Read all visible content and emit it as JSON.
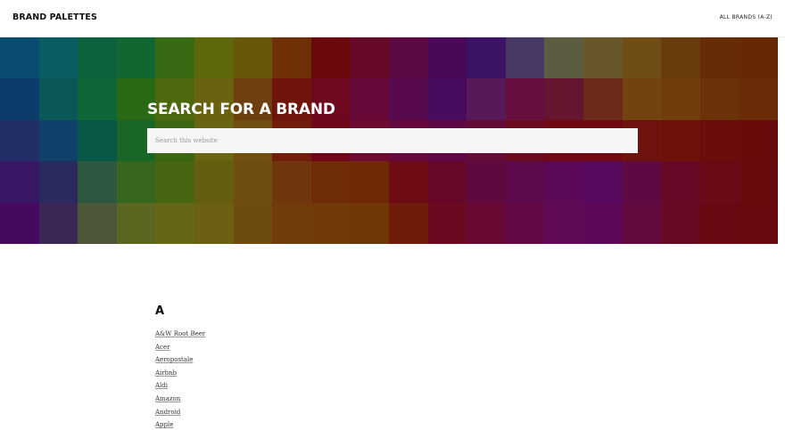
{
  "header": {
    "site_title": "BRAND PALETTES",
    "nav_link": "ALL BRANDS (A-Z)"
  },
  "hero": {
    "title": "SEARCH FOR A BRAND",
    "search_placeholder": "Search this website",
    "mosaic_colors": [
      "#0b4f73",
      "#0a5f66",
      "#0e6640",
      "#136a33",
      "#3a6d14",
      "#626c0c",
      "#6d5a0a",
      "#733208",
      "#6e0a0c",
      "#6a0a2a",
      "#5d0a45",
      "#4d0a5a",
      "#3d1468",
      "#4a3a6a",
      "#5f5f46",
      "#6c5a2a",
      "#725018",
      "#6d400e",
      "#6a2e08",
      "#6a2a08",
      "#0d3f6e",
      "#0b5a5a",
      "#0e6a3a",
      "#2c6e16",
      "#4f6d0f",
      "#6d6610",
      "#724210",
      "#74160c",
      "#720a20",
      "#6a0a3a",
      "#5a0a50",
      "#4a0d62",
      "#5a1a5a",
      "#6a1040",
      "#6a1630",
      "#702c1c",
      "#754612",
      "#75400c",
      "#6e340a",
      "#6c2e0a",
      "#24306a",
      "#10446e",
      "#0a5a4a",
      "#1a6a28",
      "#3e6a12",
      "#6c6a12",
      "#745212",
      "#761e0c",
      "#74081a",
      "#720a34",
      "#6a0a40",
      "#620a48",
      "#680c3a",
      "#700c22",
      "#740a14",
      "#740a12",
      "#72140e",
      "#72120c",
      "#6e0e0c",
      "#6c0c0c",
      "#3a1868",
      "#2c2c62",
      "#305a44",
      "#3a6a20",
      "#4a6a12",
      "#686212",
      "#745012",
      "#74380e",
      "#742e0a",
      "#742a08",
      "#720e14",
      "#6a0a2a",
      "#640a40",
      "#620a4e",
      "#5e0a5a",
      "#5a0a62",
      "#620a44",
      "#6a0a28",
      "#6c0c18",
      "#6c0c10",
      "#480a62",
      "#3e2856",
      "#4e5a3a",
      "#5e6a22",
      "#6a6a18",
      "#706414",
      "#724e10",
      "#743e0c",
      "#743c0a",
      "#743a0a",
      "#721e0c",
      "#6e0a20",
      "#6c0a36",
      "#680a48",
      "#640a58",
      "#620a5a",
      "#660a40",
      "#6a0a24",
      "#6c0a14",
      "#6c0a10"
    ]
  },
  "directory": {
    "letter": "A",
    "brands": [
      "A&W Root Beer",
      "Acer",
      "Aeropostale",
      "Airbnb",
      "Aldi",
      "Amazon",
      "Android",
      "Apple"
    ]
  }
}
